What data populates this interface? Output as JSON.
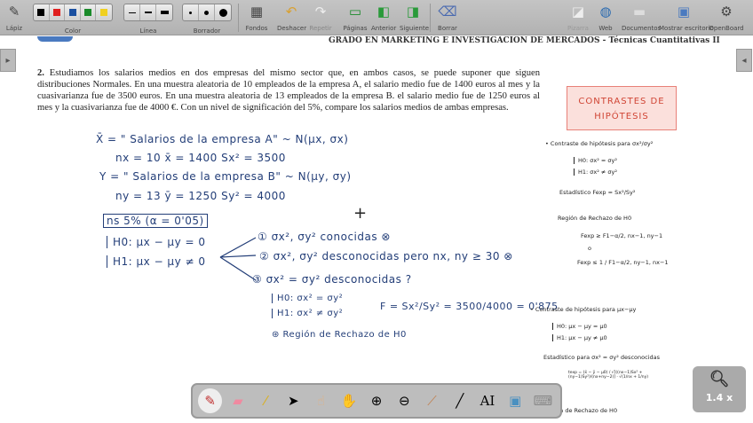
{
  "toolbar": {
    "pencil": "Lápiz",
    "color": "Color",
    "line": "Línea",
    "eraser": "Borrador",
    "backgrounds": "Fondos",
    "undo": "Deshacer",
    "redo": "Repetir",
    "pages": "Páginas",
    "previous": "Anterior",
    "next": "Siguiente",
    "clear": "Borrar",
    "board": "Pizarra",
    "web": "Web",
    "documents": "Documentos",
    "show_desktop": "Mostrar escritorio",
    "openboard": "OpenBoard",
    "colors": [
      "#000000",
      "#e02020",
      "#1a4fa0",
      "#1a8a2a",
      "#f0d020"
    ]
  },
  "document": {
    "header": "GRADO EN MARKETING E INVESTIGACION DE MERCADOS - Técnicas Cuantitativas II",
    "problem_number": "2.",
    "problem_text": "Estudiamos los salarios medios en dos empresas del mismo sector que, en ambos casos, se puede suponer que siguen distribuciones Normales. En una muestra aleatoria de 10 empleados de la empresa A, el salario medio fue de 1400 euros al mes y la cuasivarianza fue de 3500 euros. En una muestra aleatoria de 13 empleados de la empresa B. el salario medio fue de 1250 euros al mes y la cuasivarianza fue de 4000 €. Con un nivel de significación del 5%, compare los salarios medios de ambas empresas."
  },
  "handwriting": [
    "X̄ = \" Salarios de la empresa A\" ~ N(μx, σx)",
    "nx = 10     x̄ = 1400     Sx² = 3500",
    "Y = \" Salarios de la empresa B\" ~ N(μy, σy)",
    "ny = 13     ȳ = 1250     Sy² = 4000",
    "ns 5% (α = 0'05)",
    "H0: μx − μy = 0",
    "H1: μx − μy ≠ 0",
    "① σx², σy² conocidas ⊗",
    "② σx², σy² desconocidas pero nx, ny ≥ 30 ⊗",
    "③ σx² = σy² desconocidas ?",
    "H0: σx² = σy²",
    "H1: σx² ≠ σy²",
    "F = Sx²/Sy² = 3500/4000 = 0'875",
    "⊛ Región de Rechazo de H0"
  ],
  "notes": {
    "title_line1": "CONTRASTES DE",
    "title_line2": "HIPÓTESIS",
    "lines": [
      "• Contraste de hipótesis para σx²/σy²",
      "H0: σx² = σy²",
      "H1: σx² ≠ σy²",
      "Estadístico  Fexp = Sx²/Sy²",
      "Región de Rechazo de H0",
      "Fexp ≥ F1−α/2, nx−1, ny−1",
      "o",
      "Fexp ≤ 1 / F1−α/2, ny−1, nx−1",
      "• Contraste de hipótesis para μx−μy",
      "H0: μx − μy = μ0",
      "H1: μx − μy ≠ μ0",
      "Estadístico para σx² = σy² desconocidas",
      "texp = (x̄ − ȳ − μ0) / √[((nx−1)Sx² + (ny−1)Sy²)/(nx+ny−2)] · √(1/nx + 1/ny)",
      "Región de Rechazo de H0"
    ]
  },
  "zoom": {
    "level": "1.4 x"
  },
  "ink_color": "#233e78"
}
